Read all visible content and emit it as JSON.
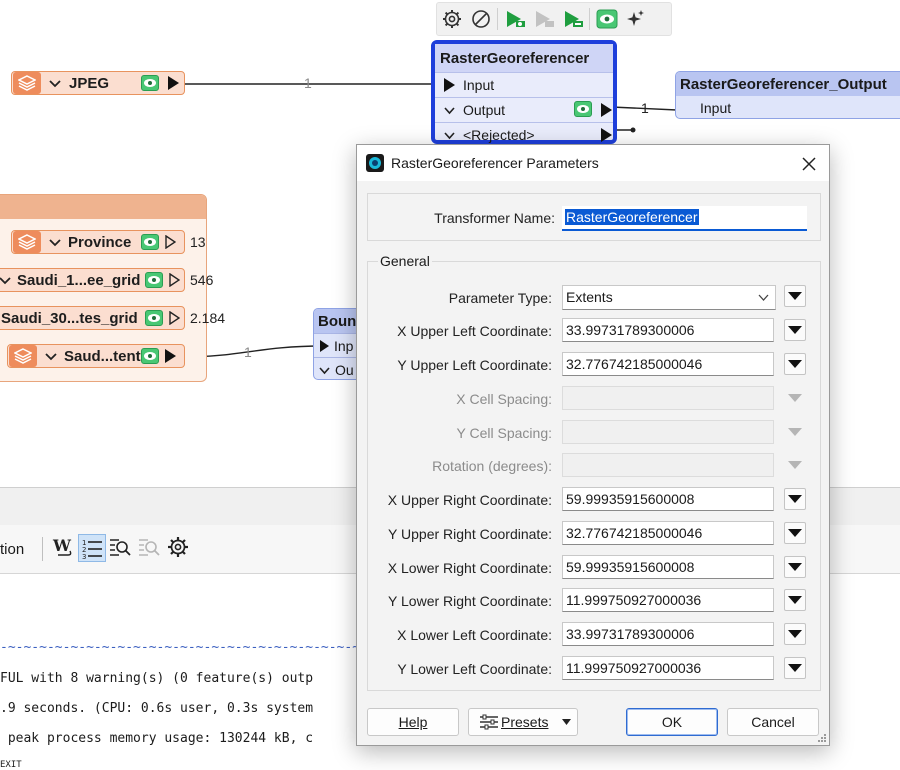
{
  "canvas": {
    "float_toolbar": {
      "buttons": [
        "gear-icon",
        "cancel-icon",
        "run-to-this-icon",
        "run-from-this-icon-disabled",
        "run-only-this-icon",
        "inspect-eye-icon",
        "sparkle-icon"
      ]
    },
    "jpeg_reader": {
      "label": "JPEG",
      "count": "1"
    },
    "raster_georeferencer": {
      "title": "RasterGeoreferencer",
      "input": "Input",
      "output": "Output",
      "rejected": "<Rejected>",
      "output_count": "1"
    },
    "output_node": {
      "title": "RasterGeoreferencer_Output",
      "input": "Input"
    },
    "bookmark_rows": [
      {
        "label": "Province",
        "count": "13"
      },
      {
        "label": "Saudi_1...ee_grid",
        "count": "546"
      },
      {
        "label": "Saudi_30...tes_grid",
        "count": "2.184"
      },
      {
        "label": "Saud...tent",
        "count": "1"
      }
    ],
    "bounds_node": {
      "title": "Boun",
      "input": "Inp",
      "output": "Ou"
    }
  },
  "panel": {
    "tab_label": "tion",
    "log_lines": [
      "-~-~-~-~-~-~-~-~-~-~-~-~-~-~-~-~-~-~-~-~-~-~-~-~-~-~-~",
      "FUL with 8 warning(s) (0 feature(s) outp",
      ".9 seconds. (CPU: 0.6s user, 0.3s system",
      " peak process memory usage: 130244 kB, c",
      "EXIT"
    ]
  },
  "dialog": {
    "title": "RasterGeoreferencer Parameters",
    "transformer_name_label": "Transformer Name:",
    "transformer_name_value": "RasterGeoreferencer",
    "general_legend": "General",
    "parameter_type_label": "Parameter Type:",
    "parameter_type_value": "Extents",
    "fields": [
      {
        "label": "X Upper Left Coordinate:",
        "value": "33.99731789300006",
        "enabled": true
      },
      {
        "label": "Y Upper Left Coordinate:",
        "value": "32.776742185000046",
        "enabled": true
      },
      {
        "label": "X Cell Spacing:",
        "value": "",
        "enabled": false
      },
      {
        "label": "Y Cell Spacing:",
        "value": "",
        "enabled": false
      },
      {
        "label": "Rotation (degrees):",
        "value": "",
        "enabled": false
      },
      {
        "label": "X Upper Right Coordinate:",
        "value": "59.99935915600008",
        "enabled": true
      },
      {
        "label": "Y Upper Right Coordinate:",
        "value": "32.776742185000046",
        "enabled": true
      },
      {
        "label": "X Lower Right Coordinate:",
        "value": "59.99935915600008",
        "enabled": true
      },
      {
        "label": "Y Lower Right Coordinate:",
        "value": "11.999750927000036",
        "enabled": true
      },
      {
        "label": "X Lower Left Coordinate:",
        "value": "33.99731789300006",
        "enabled": true
      },
      {
        "label": "Y Lower Left Coordinate:",
        "value": "11.999750927000036",
        "enabled": true
      }
    ],
    "buttons": {
      "help": "Help",
      "presets": "Presets",
      "ok": "OK",
      "cancel": "Cancel"
    }
  },
  "colors": {
    "reader_fill": "#fbded0",
    "reader_border": "#e8935e",
    "transformer_selected_border": "#1e3fdb",
    "eye_green": "#49c774",
    "selection_highlight": "#0a5ad4"
  }
}
